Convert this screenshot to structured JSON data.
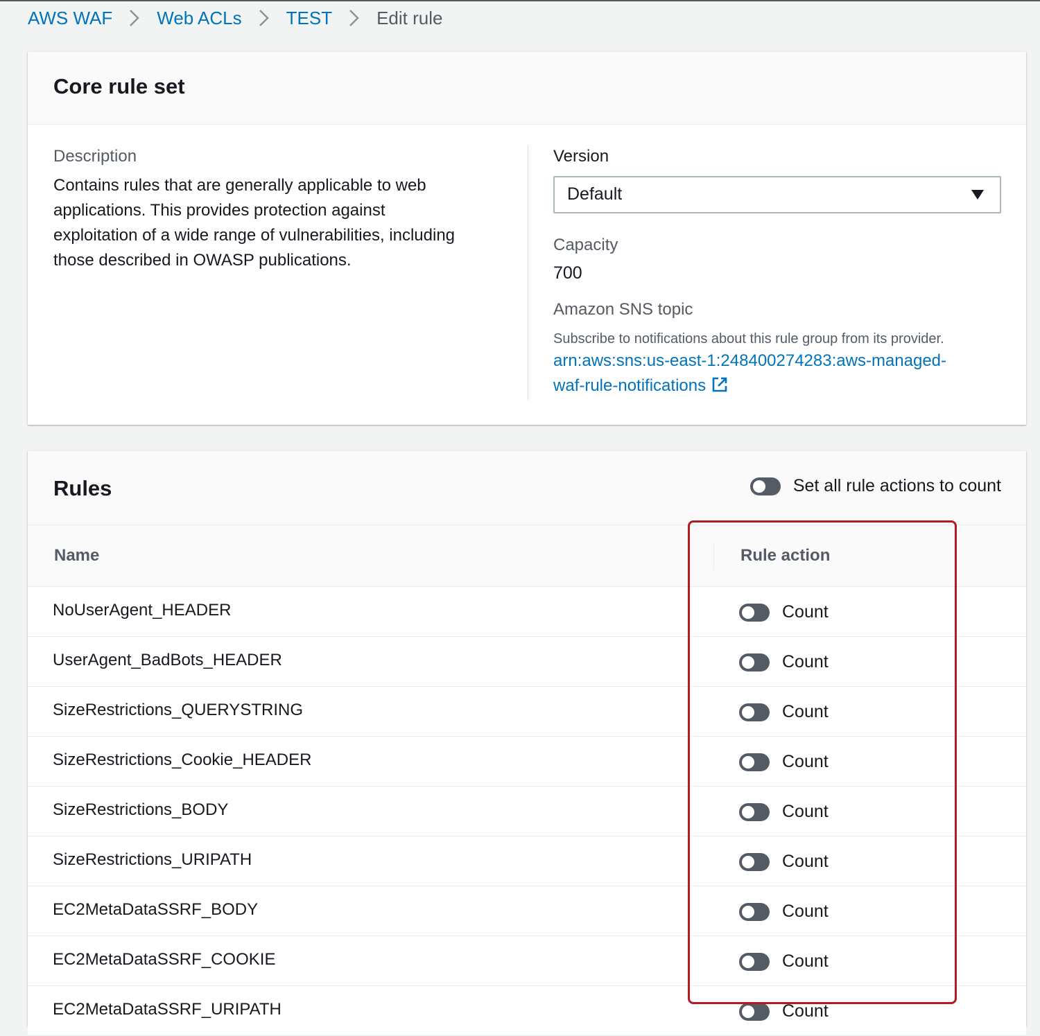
{
  "breadcrumb": {
    "items": [
      "AWS WAF",
      "Web ACLs",
      "TEST"
    ],
    "current": "Edit rule"
  },
  "core": {
    "title": "Core rule set",
    "description_label": "Description",
    "description_lines": [
      "Contains rules that are generally applicable to web",
      "applications. This provides protection against",
      "exploitation of a wide range of vulnerabilities, including",
      "those described in OWASP publications."
    ],
    "version_label": "Version",
    "version_value": "Default",
    "capacity_label": "Capacity",
    "capacity_value": "700",
    "sns_label": "Amazon SNS topic",
    "sns_subtitle": "Subscribe to notifications about this rule group from its provider.",
    "sns_link_lines": [
      "arn:aws:sns:us-east-1:248400274283:aws-managed-",
      "waf-rule-notifications"
    ]
  },
  "rules": {
    "title": "Rules",
    "set_all_label": "Set all rule actions to count",
    "columns": {
      "name": "Name",
      "action": "Rule action"
    },
    "items": [
      {
        "name": "NoUserAgent_HEADER",
        "action": "Count"
      },
      {
        "name": "UserAgent_BadBots_HEADER",
        "action": "Count"
      },
      {
        "name": "SizeRestrictions_QUERYSTRING",
        "action": "Count"
      },
      {
        "name": "SizeRestrictions_Cookie_HEADER",
        "action": "Count"
      },
      {
        "name": "SizeRestrictions_BODY",
        "action": "Count"
      },
      {
        "name": "SizeRestrictions_URIPATH",
        "action": "Count"
      },
      {
        "name": "EC2MetaDataSSRF_BODY",
        "action": "Count"
      },
      {
        "name": "EC2MetaDataSSRF_COOKIE",
        "action": "Count"
      },
      {
        "name": "EC2MetaDataSSRF_URIPATH",
        "action": "Count"
      }
    ]
  },
  "colors": {
    "link": "#0073bb",
    "highlight": "#b31b22",
    "toggle_off": "#545b64"
  },
  "icons": {
    "breadcrumb_separator": "chevron-right-icon",
    "select_caret": "caret-down-icon",
    "external_link": "external-link-icon"
  }
}
